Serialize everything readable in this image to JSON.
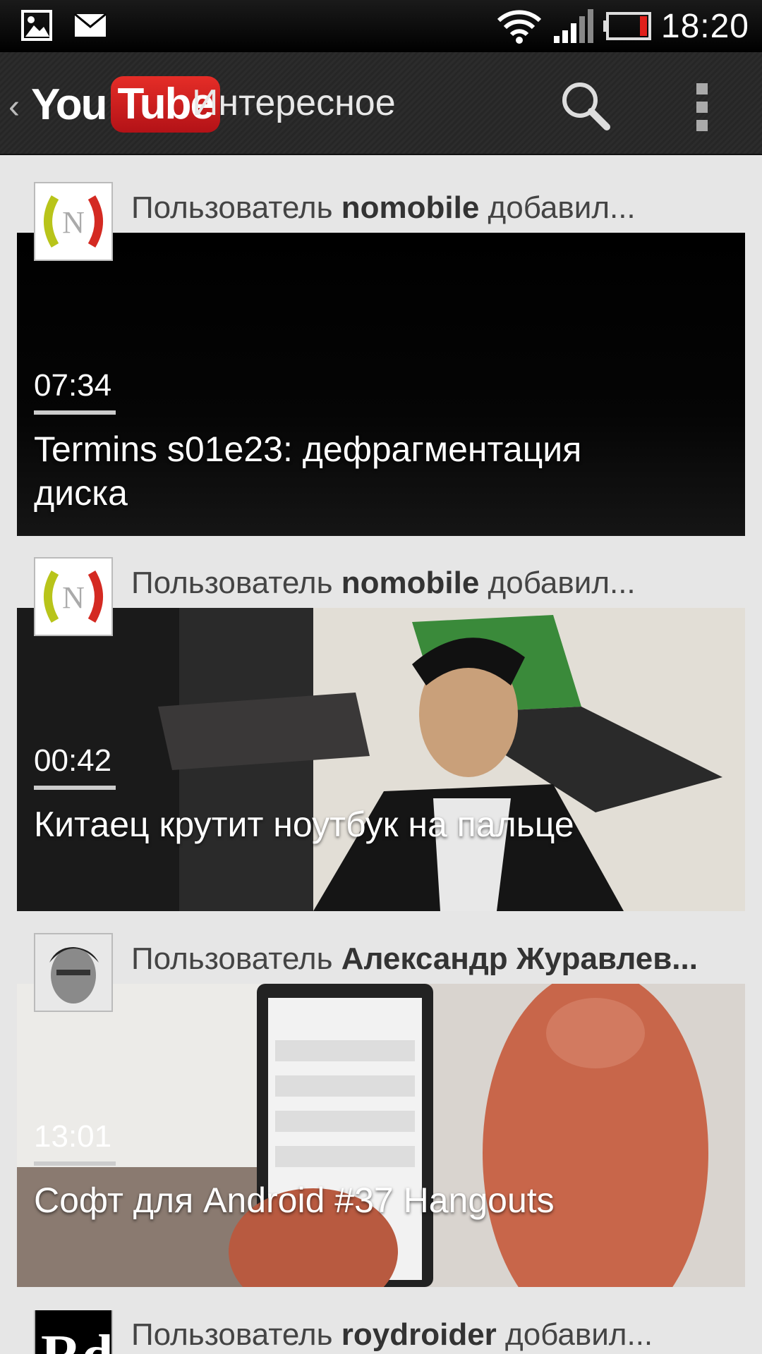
{
  "status_bar": {
    "time": "18:20",
    "icons": [
      "image-notification-icon",
      "email-notification-icon",
      "wifi-icon",
      "signal-icon",
      "battery-icon"
    ]
  },
  "action_bar": {
    "logo_you": "You",
    "logo_tube": "Tube",
    "title": "Интересное",
    "icons": [
      "back-chevron-icon",
      "search-icon",
      "overflow-menu-icon"
    ]
  },
  "feed": [
    {
      "header_prefix": "Пользователь ",
      "user": "nomobile",
      "header_suffix": " добавил...",
      "duration": "07:34",
      "title": "Termins s01e23: дефрагментация диска",
      "avatar": "nomobile-logo"
    },
    {
      "header_prefix": "Пользователь ",
      "user": "nomobile",
      "header_suffix": " добавил...",
      "duration": "00:42",
      "title": "Китаец крутит ноутбук на пальце",
      "avatar": "nomobile-logo"
    },
    {
      "header_prefix": "Пользователь ",
      "user": "Александр Журавлев...",
      "header_suffix": "",
      "duration": "13:01",
      "title": "Софт для Android #37 Hangouts",
      "avatar": "user-photo"
    },
    {
      "header_prefix": "Пользователь ",
      "user": "roydroider",
      "header_suffix": " добавил...",
      "avatar": "roydroider-logo"
    }
  ],
  "colors": {
    "background": "#e6e6e6",
    "youtube_red": "#e52d27",
    "battery_red": "#e0201a"
  }
}
